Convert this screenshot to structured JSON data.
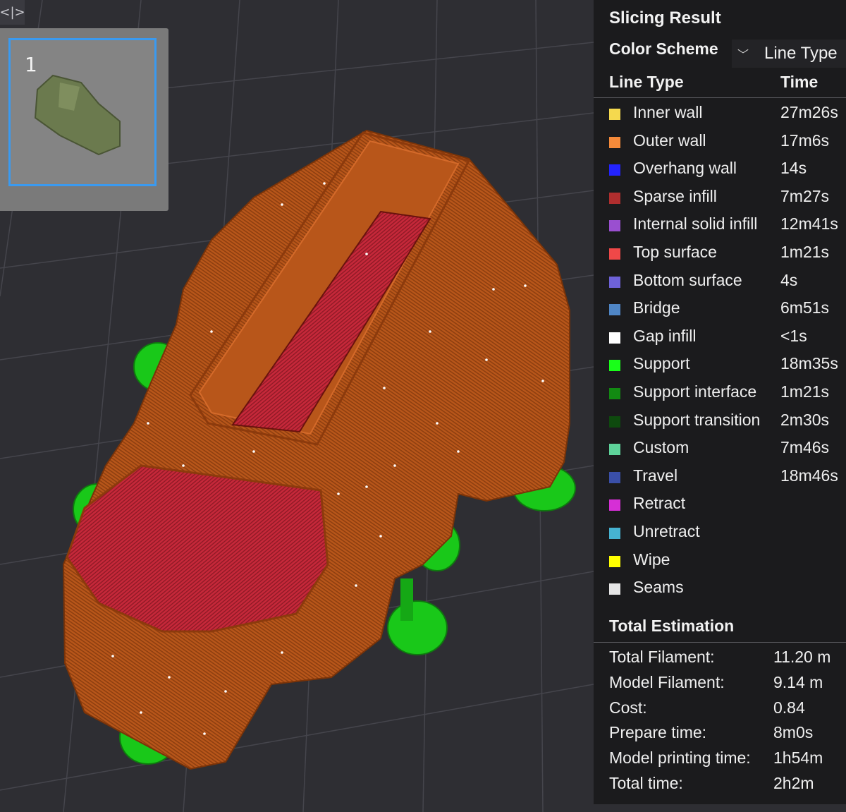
{
  "toolbar": {
    "collapse_icon": "<|>"
  },
  "plate": {
    "number": "1"
  },
  "legend": {
    "title": "Slicing Result",
    "color_scheme_label": "Color Scheme",
    "color_scheme_value": "Line Type",
    "header_type": "Line Type",
    "header_time": "Time",
    "items": [
      {
        "label": "Inner wall",
        "time": "27m26s",
        "color": "#f5d94e"
      },
      {
        "label": "Outer wall",
        "time": "17m6s",
        "color": "#f58a3a"
      },
      {
        "label": "Overhang wall",
        "time": "14s",
        "color": "#2323ff"
      },
      {
        "label": "Sparse infill",
        "time": "7m27s",
        "color": "#b02e2e"
      },
      {
        "label": "Internal solid infill",
        "time": "12m41s",
        "color": "#9a4fd0"
      },
      {
        "label": "Top surface",
        "time": "1m21s",
        "color": "#f04848"
      },
      {
        "label": "Bottom surface",
        "time": "4s",
        "color": "#6e62d8"
      },
      {
        "label": "Bridge",
        "time": "6m51s",
        "color": "#4f86c6"
      },
      {
        "label": "Gap infill",
        "time": "<1s",
        "color": "#ffffff"
      },
      {
        "label": "Support",
        "time": "18m35s",
        "color": "#19ff19"
      },
      {
        "label": "Support interface",
        "time": "1m21s",
        "color": "#128a12"
      },
      {
        "label": "Support transition",
        "time": "2m30s",
        "color": "#0e4a0e"
      },
      {
        "label": "Custom",
        "time": "7m46s",
        "color": "#5ed39a"
      },
      {
        "label": "Travel",
        "time": "18m46s",
        "color": "#3a4fa8"
      },
      {
        "label": "Retract",
        "time": "",
        "color": "#d62fd6"
      },
      {
        "label": "Unretract",
        "time": "",
        "color": "#46b3d2"
      },
      {
        "label": "Wipe",
        "time": "",
        "color": "#ffff00"
      },
      {
        "label": "Seams",
        "time": "",
        "color": "#e6e6e6"
      }
    ],
    "total_title": "Total Estimation",
    "totals": [
      {
        "key": "Total Filament:",
        "value": "11.20 m"
      },
      {
        "key": "Model Filament:",
        "value": "9.14 m"
      },
      {
        "key": "Cost:",
        "value": "0.84"
      },
      {
        "key": "Prepare time:",
        "value": "8m0s"
      },
      {
        "key": "Model printing time:",
        "value": "1h54m"
      },
      {
        "key": "Total time:",
        "value": "2h2m"
      }
    ]
  }
}
